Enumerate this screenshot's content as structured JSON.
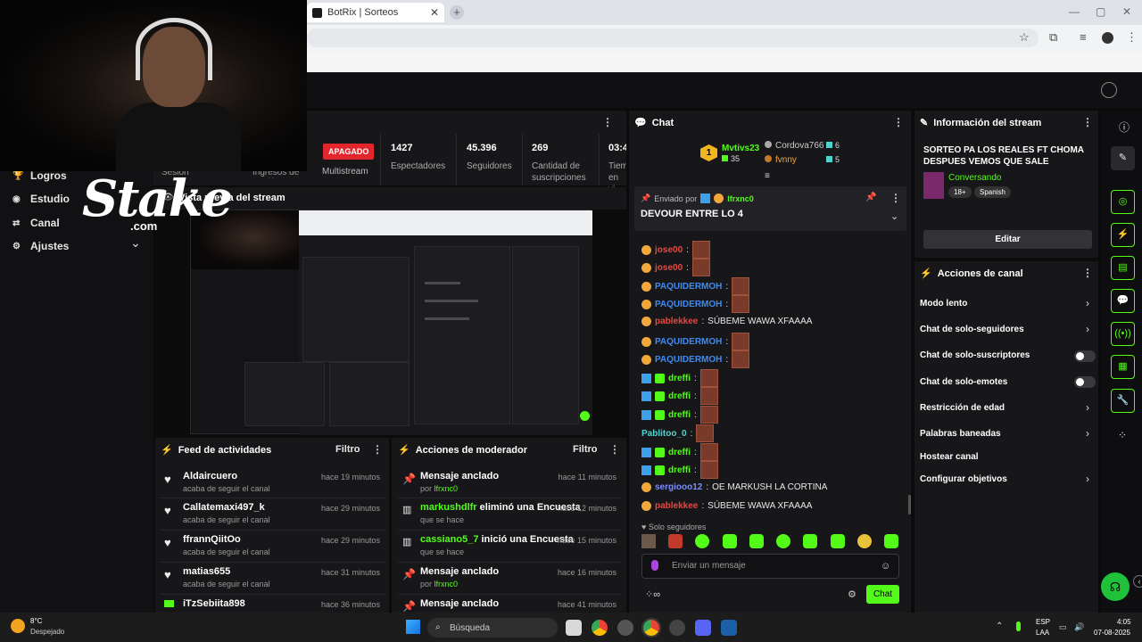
{
  "browser": {
    "tab_title": "BotRix | Sorteos",
    "tab_close": "✕",
    "new_tab": "+",
    "win_min": "—",
    "win_max": "▢",
    "win_close": "✕"
  },
  "sidebar": {
    "items": [
      {
        "label": "Logros",
        "icon": "trophy-icon"
      },
      {
        "label": "Estudio",
        "icon": "studio-icon"
      },
      {
        "label": "Canal",
        "icon": "channel-icon"
      },
      {
        "label": "Ajustes",
        "icon": "gear-icon"
      }
    ],
    "expand": "⌄"
  },
  "overlay": {
    "logo": "Stake",
    "logo_sub": ".com"
  },
  "stats": {
    "partial_labels": [
      "Sesión",
      "Ingresos de Sesió"
    ],
    "status": "APAGADO",
    "status_label": "Multistream",
    "items": [
      {
        "value": "1427",
        "label": "Espectadores"
      },
      {
        "value": "45.396",
        "label": "Seguidores"
      },
      {
        "value": "269",
        "label": "Cantidad de suscripciones"
      },
      {
        "value": "03:4",
        "label": "Tiem en vi"
      }
    ]
  },
  "preview": {
    "title": "Vista previa del stream"
  },
  "feed": {
    "title": "Feed de actividades",
    "filter": "Filtro",
    "items": [
      {
        "user": "Aldaircuero",
        "action": "acaba de seguir el canal",
        "time": "hace 19 minutos"
      },
      {
        "user": "Callatemaxi497_k",
        "action": "acaba de seguir el canal",
        "time": "hace 29 minutos"
      },
      {
        "user": "ffrannQiitOo",
        "action": "acaba de seguir el canal",
        "time": "hace 29 minutos"
      },
      {
        "user": "matias655",
        "action": "acaba de seguir el canal",
        "time": "hace 31 minutos"
      },
      {
        "user": "iTzSebiita898",
        "action": "",
        "time": "hace 36 minutos"
      }
    ]
  },
  "mod": {
    "title": "Acciones de moderador",
    "filter": "Filtro",
    "items": [
      {
        "title": "Mensaje anclado",
        "sub_prefix": "por",
        "sub_user": "lfrxnc0",
        "time": "hace 11 minutos"
      },
      {
        "title_user": "markushdlfr",
        "title": "eliminó una Encuesta",
        "sub": "que se hace",
        "time": "hace 12 minutos"
      },
      {
        "title_user": "cassiano5_7",
        "title": "inició una Encuesta",
        "sub": "que se hace",
        "time": "hace 15 minutos"
      },
      {
        "title": "Mensaje anclado",
        "sub_prefix": "por",
        "sub_user": "lfrxnc0",
        "time": "hace 16 minutos"
      },
      {
        "title": "Mensaje anclado",
        "time": "hace 41 minutos"
      }
    ]
  },
  "chat": {
    "title": "Chat",
    "leaderboard": {
      "rank1_name": "Mvtivs23",
      "rank1_value": "35",
      "rank1_badge": "1",
      "second_name": "Cordova766",
      "second_value": "6",
      "third_name": "fvnny",
      "third_value": "5"
    },
    "pinned": {
      "prefix": "Enviado por",
      "user": "lfrxnc0",
      "message": "DEVOUR ENTRE LO 4"
    },
    "messages": [
      {
        "user": "jose00",
        "text": "",
        "color": "#e9473f"
      },
      {
        "user": "jose00",
        "text": "",
        "color": "#e9473f"
      },
      {
        "user": "PAQUIDERMOH",
        "text": "",
        "color": "#3d8bf2"
      },
      {
        "user": "PAQUIDERMOH",
        "text": "",
        "color": "#3d8bf2"
      },
      {
        "user": "pablekkee",
        "text": "SÚBEME WAWA XFAAAA",
        "color": "#e9473f"
      },
      {
        "user": "PAQUIDERMOH",
        "text": "",
        "color": "#3d8bf2"
      },
      {
        "user": "PAQUIDERMOH",
        "text": "",
        "color": "#3d8bf2"
      },
      {
        "user": "dreffi",
        "text": "",
        "color": "#53fc18"
      },
      {
        "user": "dreffi",
        "text": "",
        "color": "#53fc18"
      },
      {
        "user": "dreffi",
        "text": "",
        "color": "#53fc18"
      },
      {
        "user": "Pablitoo_0",
        "text": "",
        "color": "#4ed4d0"
      },
      {
        "user": "dreffi",
        "text": "",
        "color": "#53fc18"
      },
      {
        "user": "dreffi",
        "text": "",
        "color": "#53fc18"
      },
      {
        "user": "sergiooo12",
        "text": "OE MARKUSH LA CORTINA",
        "color": "#7a8cff"
      },
      {
        "user": "pablekkee",
        "text": "SÚBEME WAWA XFAAAA",
        "color": "#e9473f"
      }
    ],
    "mode_label": "Solo seguidores",
    "input_placeholder": "Enviar un mensaje",
    "send": "Chat"
  },
  "info": {
    "title": "Información del stream",
    "stream_title": "SORTEO PA LOS REALES FT CHOMA DESPUES VEMOS QUE SALE",
    "category": "Conversando",
    "age": "18+",
    "language": "Spanish",
    "edit": "Editar"
  },
  "actions": {
    "title": "Acciones de canal",
    "items": [
      {
        "label": "Modo lento",
        "control": "chevron"
      },
      {
        "label": "Chat de solo-seguidores",
        "control": "chevron"
      },
      {
        "label": "Chat de solo-suscriptores",
        "control": "toggle"
      },
      {
        "label": "Chat de solo-emotes",
        "control": "toggle"
      },
      {
        "label": "Restricción de edad",
        "control": "chevron"
      },
      {
        "label": "Palabras baneadas",
        "control": "chevron"
      },
      {
        "label": "Hostear canal",
        "control": "none"
      },
      {
        "label": "Configurar objetivos",
        "control": "chevron"
      }
    ]
  },
  "taskbar": {
    "temp": "8°C",
    "weather": "Despejado",
    "search": "Búsqueda",
    "lang1": "ESP",
    "lang2": "LAA",
    "time": "4:05",
    "date": "07-08-2025"
  },
  "colors": {
    "accent": "#53fc18",
    "danger": "#e3262e",
    "panel": "#17171a"
  }
}
